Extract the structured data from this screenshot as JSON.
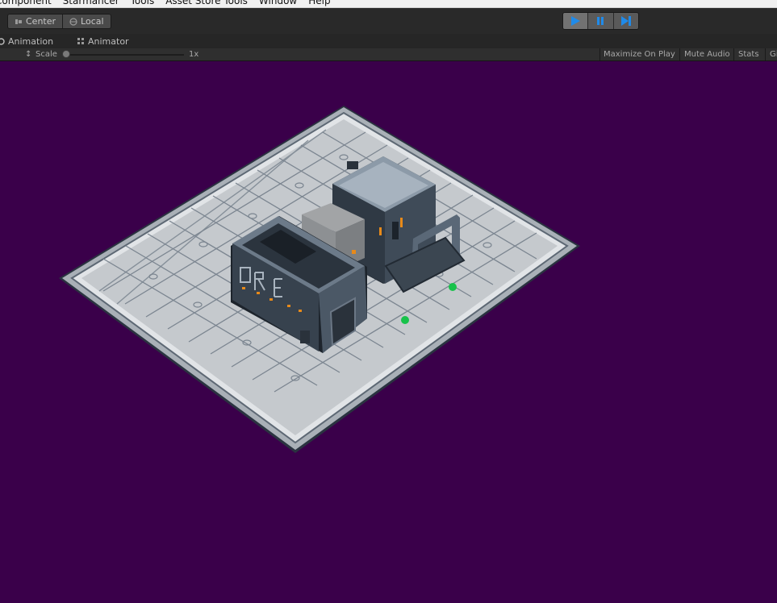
{
  "menubar": {
    "items": [
      "Component",
      "Starmancer",
      "Tools",
      "Asset Store Tools",
      "Window",
      "Help"
    ]
  },
  "toolbar": {
    "pivot": {
      "center_label": "Center",
      "local_label": "Local"
    },
    "play_controls": [
      "play-icon",
      "pause-icon",
      "step-icon"
    ]
  },
  "tabs": {
    "animation_label": "Animation",
    "animator_label": "Animator"
  },
  "game_toolbar": {
    "scale_label": "Scale",
    "scale_value": "1x",
    "maximize_label": "Maximize On Play",
    "mute_label": "Mute Audio",
    "stats_label": "Stats",
    "gizmos_label": "Gi"
  },
  "colors": {
    "viewport_bg": "#3a004a",
    "play_accent": "#1f8bea",
    "floor": "#c9cccf",
    "building": "#3c4754",
    "accent_orange": "#e78a1a",
    "marker_green": "#17c24a"
  }
}
